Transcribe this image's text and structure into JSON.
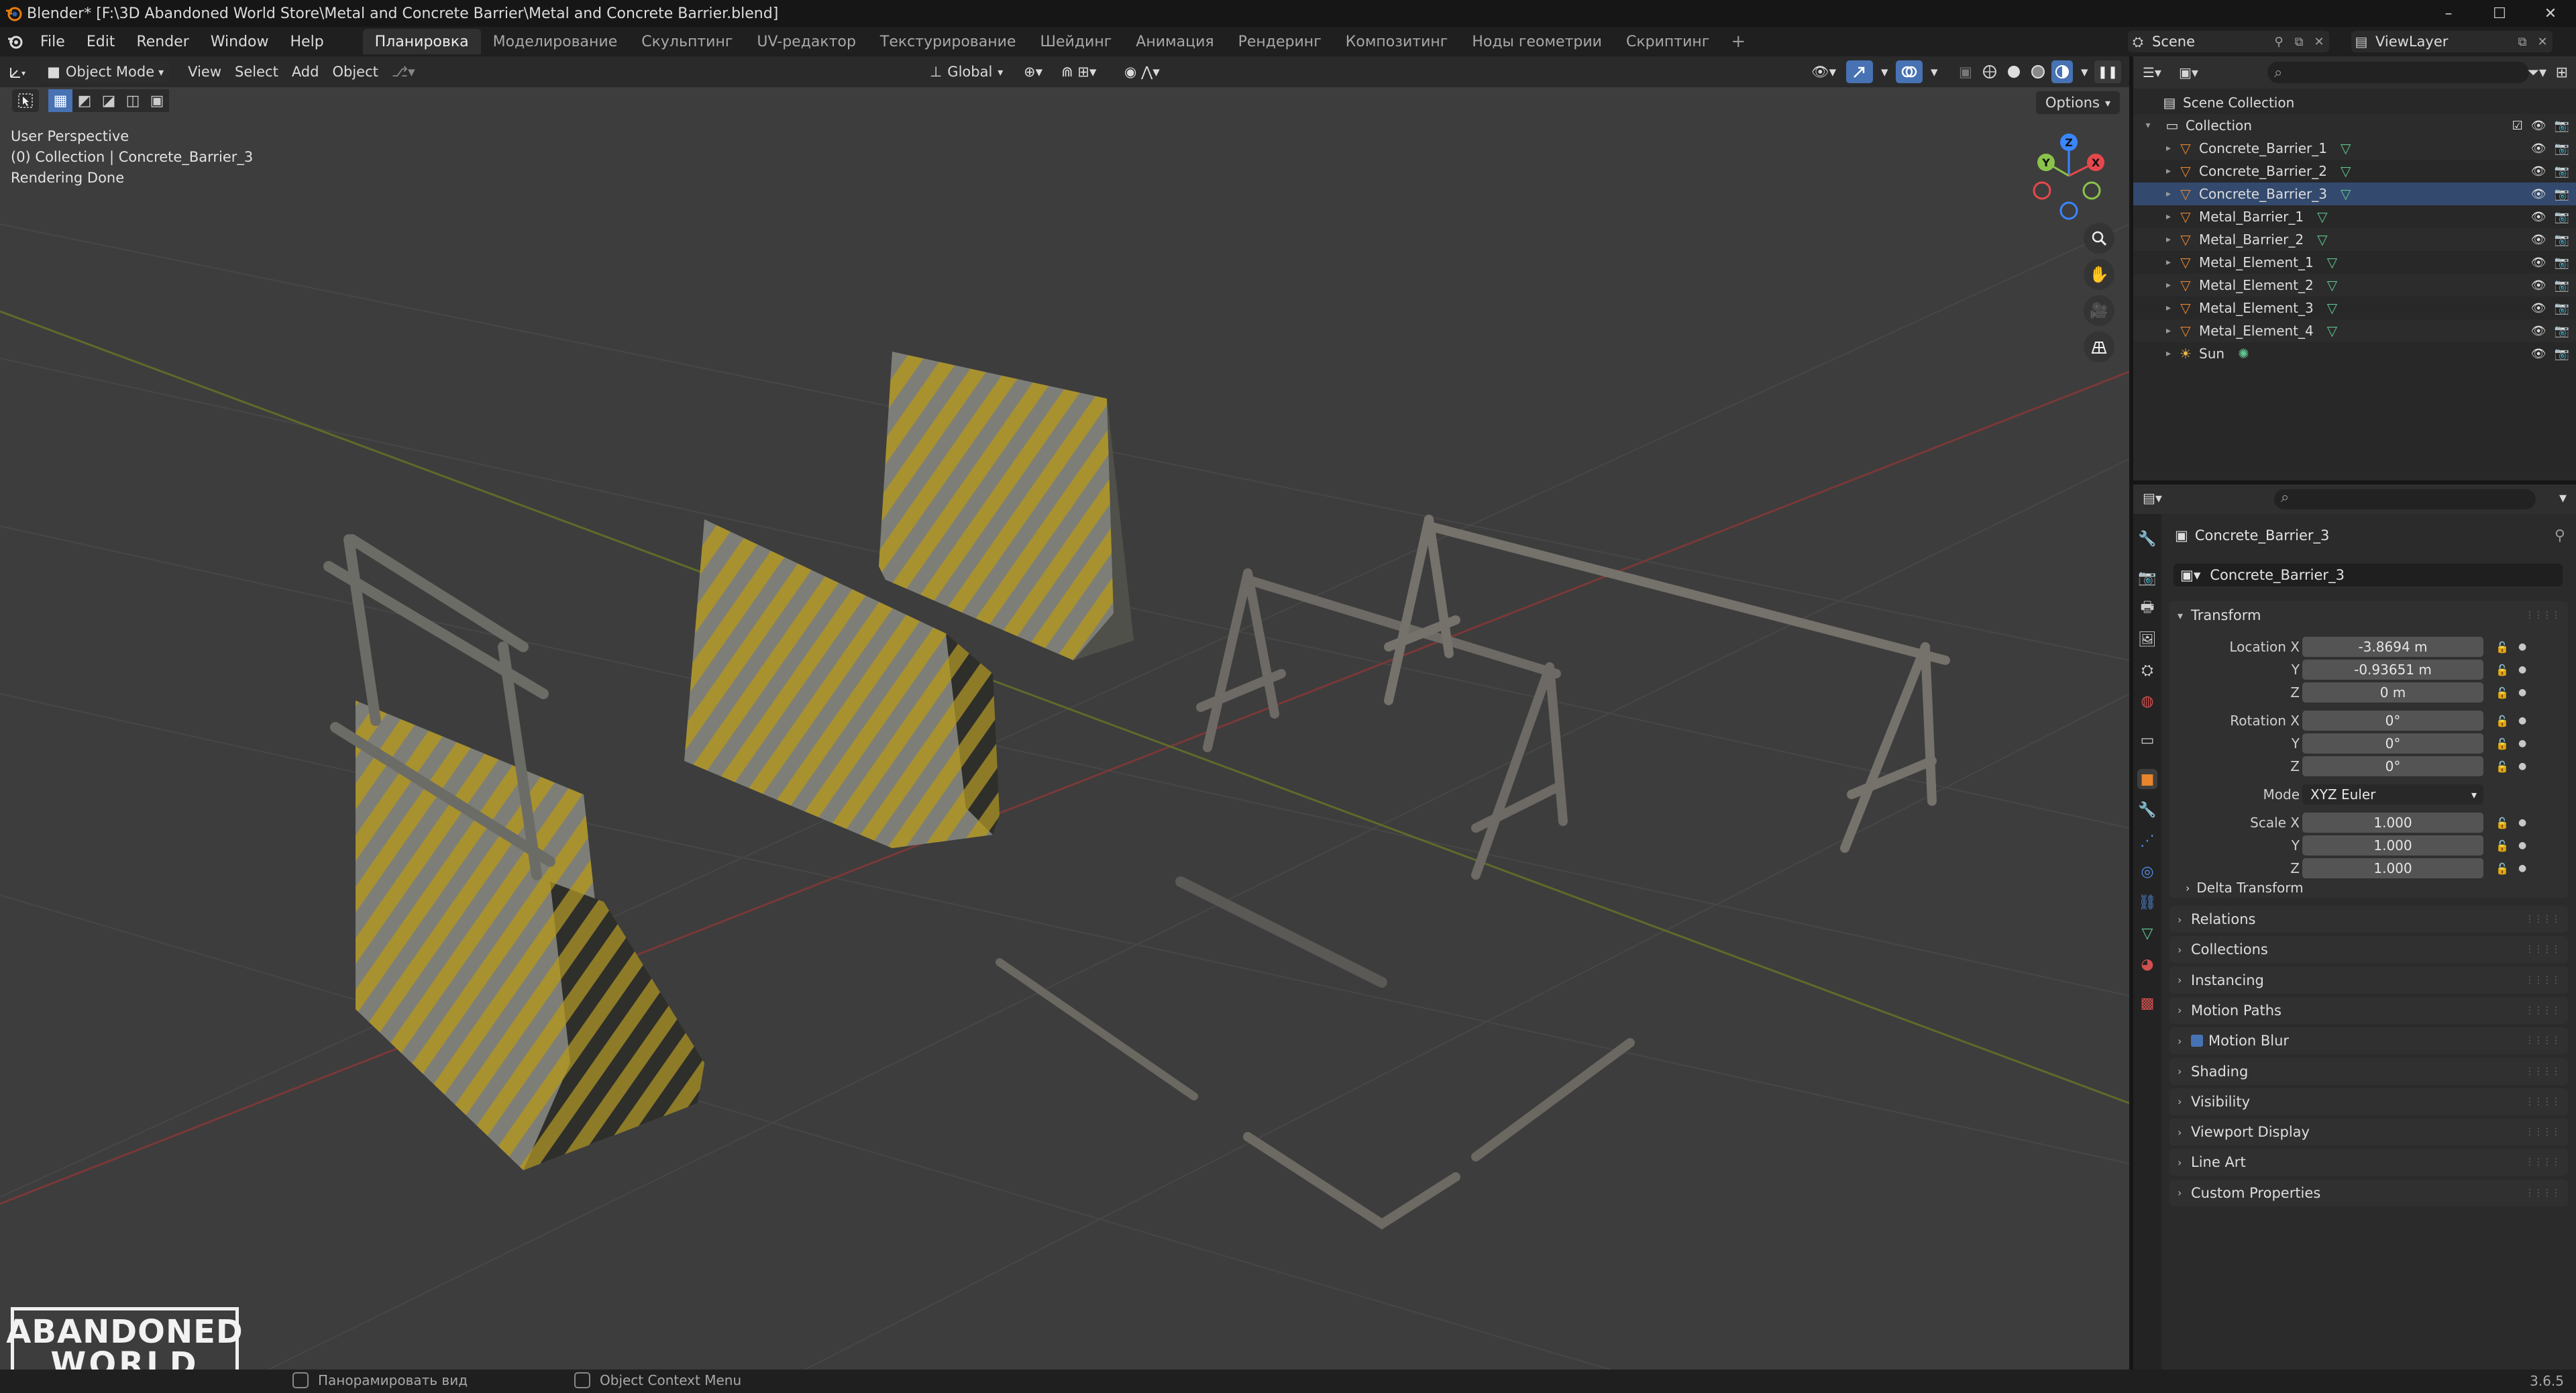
{
  "window": {
    "title": "Blender* [F:\\3D Abandoned World Store\\Metal and Concrete Barrier\\Metal and Concrete Barrier.blend]",
    "minimize": "–",
    "maximize": "☐",
    "close": "✕"
  },
  "menu": [
    "File",
    "Edit",
    "Render",
    "Window",
    "Help"
  ],
  "workspaces": [
    "Планировка",
    "Моделирование",
    "Скульптинг",
    "UV-редактор",
    "Текстурирование",
    "Шейдинг",
    "Анимация",
    "Рендеринг",
    "Композитинг",
    "Ноды геометрии",
    "Скриптинг"
  ],
  "workspace_add": "+",
  "scene": {
    "name": "Scene",
    "view_layer": "ViewLayer"
  },
  "viewport": {
    "mode": "Object Mode",
    "menus": [
      "View",
      "Select",
      "Add",
      "Object"
    ],
    "orientation": "Global",
    "options": "Options",
    "info": {
      "perspective": "User Perspective",
      "collection": "(0) Collection | Concrete_Barrier_3",
      "status": "Rendering Done"
    },
    "gizmo_axes": {
      "x": "X",
      "y": "Y",
      "z": "Z"
    },
    "logo": {
      "line1": "ABANDONED",
      "line2": "WORLD"
    }
  },
  "outliner": {
    "root": "Scene Collection",
    "collection": "Collection",
    "items": [
      {
        "name": "Concrete_Barrier_1",
        "type": "mesh"
      },
      {
        "name": "Concrete_Barrier_2",
        "type": "mesh"
      },
      {
        "name": "Concrete_Barrier_3",
        "type": "mesh",
        "selected": true
      },
      {
        "name": "Metal_Barrier_1",
        "type": "mesh"
      },
      {
        "name": "Metal_Barrier_2",
        "type": "mesh"
      },
      {
        "name": "Metal_Element_1",
        "type": "mesh"
      },
      {
        "name": "Metal_Element_2",
        "type": "mesh"
      },
      {
        "name": "Metal_Element_3",
        "type": "mesh"
      },
      {
        "name": "Metal_Element_4",
        "type": "mesh"
      },
      {
        "name": "Sun",
        "type": "light"
      }
    ]
  },
  "properties": {
    "object_name": "Concrete_Barrier_3",
    "object_field": "Concrete_Barrier_3",
    "transform": {
      "title": "Transform",
      "location_label": "Location X",
      "location": [
        "-3.8694 m",
        "-0.93651 m",
        "0 m"
      ],
      "rotation_label": "Rotation X",
      "rotation": [
        "0°",
        "0°",
        "0°"
      ],
      "mode_label": "Mode",
      "mode": "XYZ Euler",
      "scale_label": "Scale X",
      "scale": [
        "1.000",
        "1.000",
        "1.000"
      ],
      "y": "Y",
      "z": "Z",
      "delta": "Delta Transform"
    },
    "panels": [
      "Relations",
      "Collections",
      "Instancing",
      "Motion Paths",
      "Motion Blur",
      "Shading",
      "Visibility",
      "Viewport Display",
      "Line Art",
      "Custom Properties"
    ]
  },
  "status": {
    "pan": "Панорамировать вид",
    "context": "Object Context Menu",
    "version": "3.6.5"
  },
  "colors": {
    "accent": "#4772b3",
    "axis_x": "#e5484d",
    "axis_y": "#8bc34a",
    "axis_z": "#3a86ff",
    "mesh_icon": "#e8842c",
    "data_icon": "#5fc48d"
  }
}
